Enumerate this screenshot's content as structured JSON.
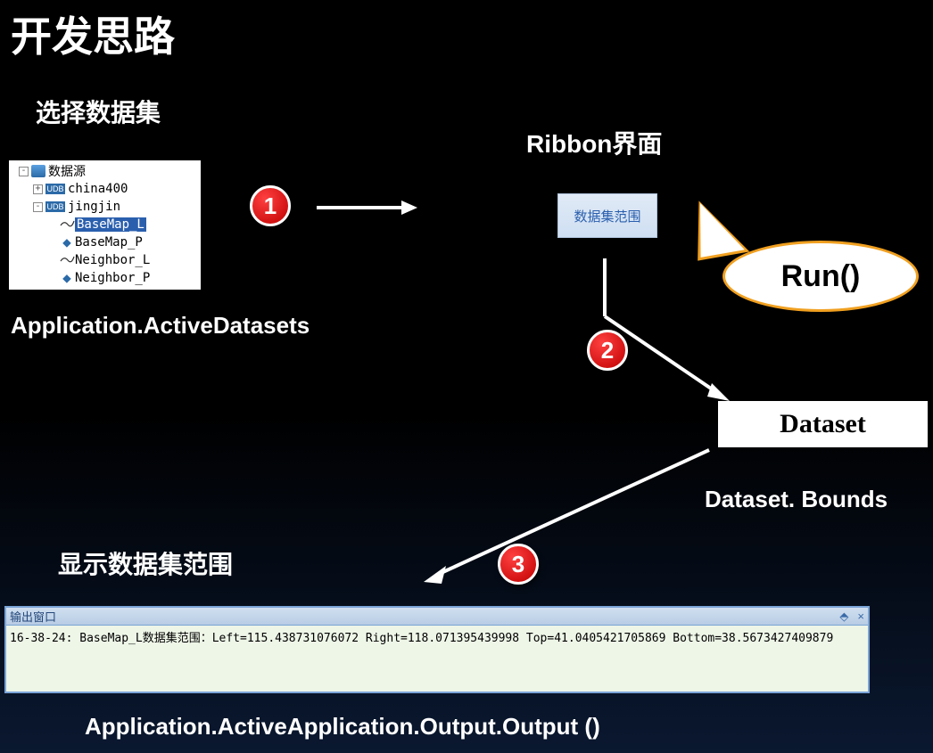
{
  "title": "开发思路",
  "section_select": "选择数据集",
  "ribbon_label": "Ribbon界面",
  "api_active_datasets": "Application.ActiveDatasets",
  "section_show": "显示数据集范围",
  "api_output": "Application.ActiveApplication.Output.Output ()",
  "run_label": "Run()",
  "ribbon_button": "数据集范围",
  "dataset_box": "Dataset",
  "dataset_bounds": "Dataset. Bounds",
  "steps": {
    "s1": "1",
    "s2": "2",
    "s3": "3"
  },
  "tree": {
    "root": "数据源",
    "items": [
      {
        "type": "udb",
        "label": "china400"
      },
      {
        "type": "udb",
        "label": "jingjin"
      },
      {
        "type": "line",
        "label": "BaseMap_L",
        "selected": true
      },
      {
        "type": "point",
        "label": "BaseMap_P"
      },
      {
        "type": "line",
        "label": "Neighbor_L"
      },
      {
        "type": "point",
        "label": "Neighbor_P"
      }
    ]
  },
  "output": {
    "title": "输出窗口",
    "pin": "📌",
    "close": "×",
    "line": "16-38-24: BaseMap_L数据集范围：Left=115.438731076072 Right=118.071395439998 Top=41.0405421705869 Bottom=38.5673427409879"
  }
}
